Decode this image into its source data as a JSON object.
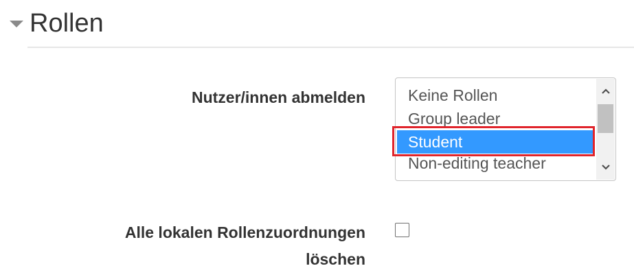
{
  "section": {
    "title": "Rollen",
    "collapse_icon": "triangle-down-icon"
  },
  "unenrol": {
    "label": "Nutzer/innen abmelden",
    "options": [
      {
        "label": "Keine Rollen",
        "selected": false
      },
      {
        "label": "Group leader",
        "selected": false
      },
      {
        "label": "Student",
        "selected": true
      },
      {
        "label": "Non-editing teacher",
        "selected": false
      }
    ],
    "selected_color": "#3399ff",
    "highlight_color": "#e0242b",
    "scroll_up_icon": "chevron-up-icon",
    "scroll_down_icon": "chevron-down-icon"
  },
  "remove_roles": {
    "label_line1": "Alle lokalen Rollenzuordnungen",
    "label_line2": "löschen",
    "checked": false
  }
}
